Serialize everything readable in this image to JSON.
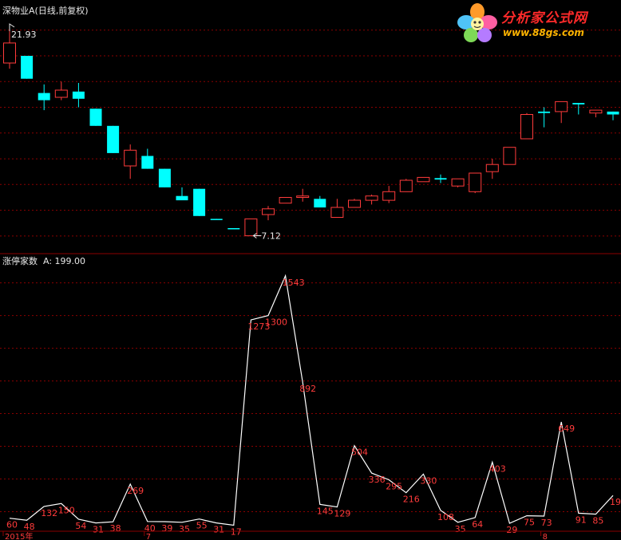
{
  "upper_panel": {
    "title": "深物业A(日线,前复权)",
    "max_label": "21.93",
    "min_label": "7.12"
  },
  "lower_panel": {
    "indicator_name": "涨停家数",
    "value_label": "A: 199.00"
  },
  "x_axis_labels": [
    {
      "index": 0,
      "text": "2015年"
    },
    {
      "index": 8,
      "text": "7"
    },
    {
      "index": 31,
      "text": "8"
    }
  ],
  "logo": {
    "name": "分析家公式网",
    "url": "www.88gs.com"
  },
  "colors": {
    "background": "#000000",
    "up": "#ff3b3b",
    "down": "#00ffff",
    "line": "#ffffff",
    "value_label": "#ff3b3b",
    "grid": "#8b0000",
    "text": "#e8e8e8"
  },
  "chart_data": [
    {
      "type": "candlestick",
      "title": "深物业A(日线,前复权)",
      "ylim": [
        6.2,
        22.6
      ],
      "grid": true,
      "candles": [
        {
          "open": 19.2,
          "close": 20.6,
          "high": 21.93,
          "low": 18.8
        },
        {
          "open": 19.7,
          "close": 18.1,
          "high": 19.7,
          "low": 18.1
        },
        {
          "open": 17.1,
          "close": 16.6,
          "high": 17.7,
          "low": 15.9
        },
        {
          "open": 16.8,
          "close": 17.3,
          "high": 17.9,
          "low": 16.6
        },
        {
          "open": 17.2,
          "close": 16.7,
          "high": 17.8,
          "low": 16.1
        },
        {
          "open": 16.0,
          "close": 14.8,
          "high": 16.0,
          "low": 14.8
        },
        {
          "open": 14.8,
          "close": 12.9,
          "high": 14.8,
          "low": 12.9
        },
        {
          "open": 12.0,
          "close": 13.1,
          "high": 13.5,
          "low": 11.1
        },
        {
          "open": 12.7,
          "close": 11.8,
          "high": 13.2,
          "low": 11.8
        },
        {
          "open": 11.8,
          "close": 10.5,
          "high": 11.8,
          "low": 10.5
        },
        {
          "open": 9.9,
          "close": 9.6,
          "high": 10.5,
          "low": 9.6
        },
        {
          "open": 10.4,
          "close": 8.5,
          "high": 10.4,
          "low": 8.5
        },
        {
          "open": 8.3,
          "close": 8.25,
          "high": 8.3,
          "low": 8.25
        },
        {
          "open": 7.65,
          "close": 7.6,
          "high": 7.65,
          "low": 7.6
        },
        {
          "open": 7.12,
          "close": 8.3,
          "high": 8.3,
          "low": 7.12
        },
        {
          "open": 8.6,
          "close": 9.0,
          "high": 9.2,
          "low": 8.2
        },
        {
          "open": 9.4,
          "close": 9.8,
          "high": 9.8,
          "low": 9.4
        },
        {
          "open": 9.8,
          "close": 9.9,
          "high": 10.4,
          "low": 9.5
        },
        {
          "open": 9.7,
          "close": 9.1,
          "high": 9.9,
          "low": 9.1
        },
        {
          "open": 8.4,
          "close": 9.1,
          "high": 9.7,
          "low": 8.4
        },
        {
          "open": 9.1,
          "close": 9.6,
          "high": 9.7,
          "low": 9.1
        },
        {
          "open": 9.6,
          "close": 9.9,
          "high": 10.0,
          "low": 9.3
        },
        {
          "open": 9.6,
          "close": 10.2,
          "high": 10.6,
          "low": 9.4
        },
        {
          "open": 10.2,
          "close": 11.0,
          "high": 11.1,
          "low": 10.2
        },
        {
          "open": 10.9,
          "close": 11.2,
          "high": 11.2,
          "low": 10.9
        },
        {
          "open": 11.15,
          "close": 11.05,
          "high": 11.4,
          "low": 10.8
        },
        {
          "open": 10.6,
          "close": 11.1,
          "high": 11.1,
          "low": 10.5
        },
        {
          "open": 10.2,
          "close": 11.5,
          "high": 11.5,
          "low": 10.1
        },
        {
          "open": 11.6,
          "close": 12.1,
          "high": 12.5,
          "low": 11.1
        },
        {
          "open": 12.1,
          "close": 13.3,
          "high": 13.3,
          "low": 12.1
        },
        {
          "open": 13.9,
          "close": 15.6,
          "high": 15.7,
          "low": 13.9
        },
        {
          "open": 15.8,
          "close": 15.7,
          "high": 16.1,
          "low": 14.7
        },
        {
          "open": 15.8,
          "close": 16.5,
          "high": 16.5,
          "low": 15.0
        },
        {
          "open": 16.4,
          "close": 16.3,
          "high": 16.4,
          "low": 15.6
        },
        {
          "open": 15.7,
          "close": 15.9,
          "high": 15.9,
          "low": 15.4
        },
        {
          "open": 15.8,
          "close": 15.6,
          "high": 15.8,
          "low": 15.2
        }
      ]
    },
    {
      "type": "line",
      "title": "涨停家数",
      "ylim": [
        0,
        1620
      ],
      "grid": true,
      "series": [
        {
          "values": [
            60,
            48,
            132,
            150,
            54,
            31,
            38,
            269,
            40,
            39,
            35,
            55,
            31,
            17,
            1273,
            1300,
            1543,
            892,
            145,
            129,
            504,
            336,
            295,
            216,
            330,
            108,
            35,
            64,
            403,
            29,
            75,
            73,
            649,
            91,
            85,
            199
          ]
        }
      ]
    }
  ]
}
